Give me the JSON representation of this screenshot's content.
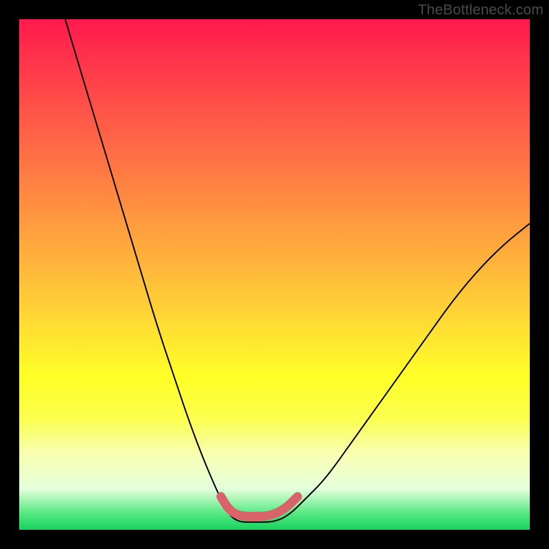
{
  "watermark": "TheBottleneck.com",
  "chart_data": {
    "type": "line",
    "title": "",
    "xlabel": "",
    "ylabel": "",
    "xlim": [
      0,
      1
    ],
    "ylim": [
      0,
      1
    ],
    "series": [
      {
        "name": "bottleneck-curve",
        "x": [
          0.09,
          0.12,
          0.15,
          0.18,
          0.21,
          0.24,
          0.27,
          0.3,
          0.33,
          0.36,
          0.39,
          0.41,
          0.43,
          0.46,
          0.5,
          0.53,
          0.56,
          0.6,
          0.65,
          0.7,
          0.75,
          0.8,
          0.85,
          0.9,
          0.95,
          1.0
        ],
        "y": [
          1.0,
          0.9,
          0.8,
          0.7,
          0.6,
          0.5,
          0.4,
          0.31,
          0.22,
          0.14,
          0.07,
          0.03,
          0.015,
          0.015,
          0.015,
          0.03,
          0.06,
          0.1,
          0.17,
          0.24,
          0.31,
          0.38,
          0.45,
          0.51,
          0.56,
          0.6
        ]
      },
      {
        "name": "highlight-segment",
        "x": [
          0.395,
          0.41,
          0.43,
          0.46,
          0.49,
          0.52,
          0.545
        ],
        "y": [
          0.065,
          0.04,
          0.027,
          0.026,
          0.027,
          0.04,
          0.065
        ]
      }
    ],
    "colors": {
      "curve": "#000000",
      "highlight": "#d9636a"
    }
  }
}
